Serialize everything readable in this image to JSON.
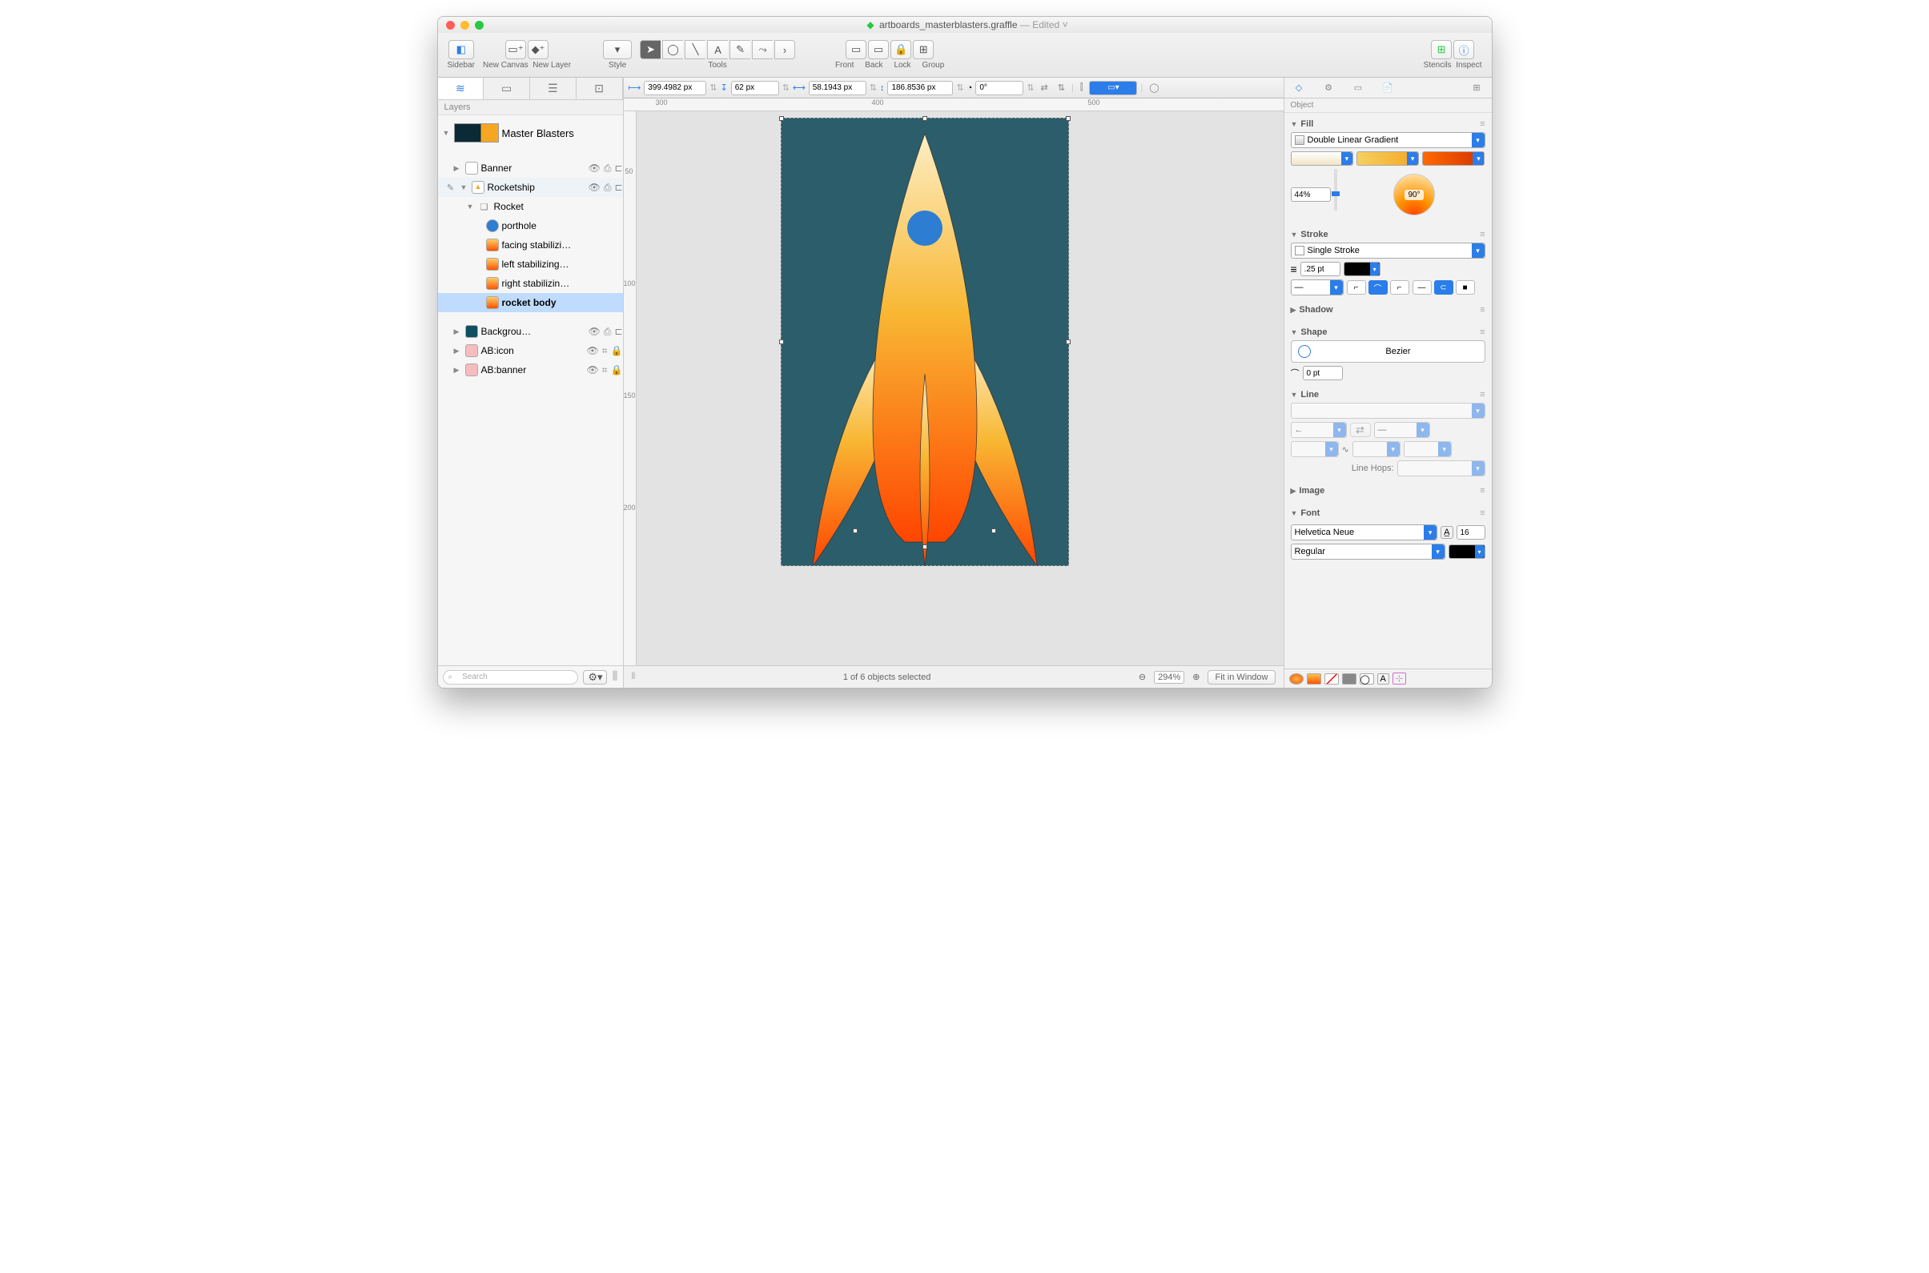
{
  "window": {
    "filename": "artboards_masterblasters.graffle",
    "status": "— Edited"
  },
  "toolbar": {
    "sidebar": "Sidebar",
    "new_canvas": "New Canvas",
    "new_layer": "New Layer",
    "style": "Style",
    "tools": "Tools",
    "front": "Front",
    "back": "Back",
    "lock": "Lock",
    "group": "Group",
    "stencils": "Stencils",
    "inspect": "Inspect"
  },
  "sidebar": {
    "header": "Layers",
    "canvas": "Master Blasters",
    "layers": [
      "Banner",
      "Rocketship",
      "Rocket",
      "porthole",
      "facing stabilizi…",
      "left stabilizing…",
      "right stabilizin…",
      "rocket body",
      "Backgrou…",
      "AB:icon",
      "AB:banner"
    ],
    "search_placeholder": "Search"
  },
  "ruler": {
    "x": "399.4982 px",
    "y": "62 px",
    "w": "58.1943 px",
    "h": "186.8536 px",
    "angle": "0°",
    "tick1": "300",
    "tick2": "400",
    "tick3": "500"
  },
  "ruler_v": {
    "t1": "50",
    "t2": "100",
    "t3": "150",
    "t4": "200"
  },
  "status": {
    "selection": "1 of 6 objects selected",
    "zoom": "294%",
    "fit": "Fit in Window"
  },
  "inspector": {
    "header": "Object",
    "fill": {
      "title": "Fill",
      "type": "Double Linear Gradient",
      "blend": "44%",
      "angle": "90°"
    },
    "stroke": {
      "title": "Stroke",
      "type": "Single Stroke",
      "width": ".25 pt"
    },
    "shadow": {
      "title": "Shadow"
    },
    "shape": {
      "title": "Shape",
      "name": "Bezier",
      "corner": "0 pt"
    },
    "line": {
      "title": "Line",
      "hops": "Line Hops:"
    },
    "image": {
      "title": "Image"
    },
    "font": {
      "title": "Font",
      "family": "Helvetica Neue",
      "size": "16",
      "weight": "Regular"
    }
  }
}
